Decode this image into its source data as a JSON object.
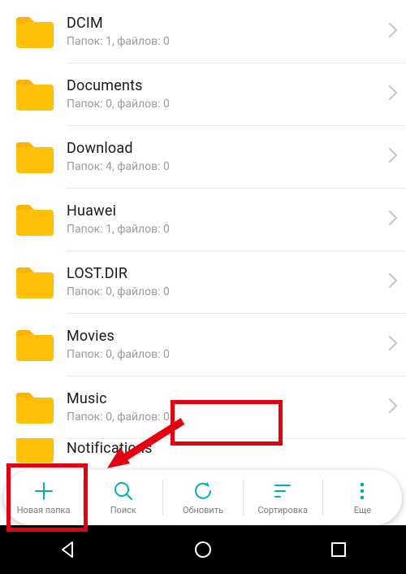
{
  "folders": [
    {
      "name": "DCIM",
      "sub": "Папок: 1, файлов: 0"
    },
    {
      "name": "Documents",
      "sub": "Папок: 0, файлов: 0"
    },
    {
      "name": "Download",
      "sub": "Папок: 4, файлов: 0"
    },
    {
      "name": "Huawei",
      "sub": "Папок: 1, файлов: 0"
    },
    {
      "name": "LOST.DIR",
      "sub": "Папок: 0, файлов: 0"
    },
    {
      "name": "Movies",
      "sub": "Папок: 0, файлов: 0"
    },
    {
      "name": "Music",
      "sub": "Папок: 0, файлов: 0"
    },
    {
      "name": "Notifications",
      "sub": ""
    }
  ],
  "toolbar": {
    "new_folder": "Новая папка",
    "search": "Поиск",
    "refresh": "Обновить",
    "sort": "Сортировка",
    "more": "Еще"
  },
  "colors": {
    "accent": "#00b0b9",
    "folder": "#ffc107",
    "annotation": "#e3000f"
  }
}
